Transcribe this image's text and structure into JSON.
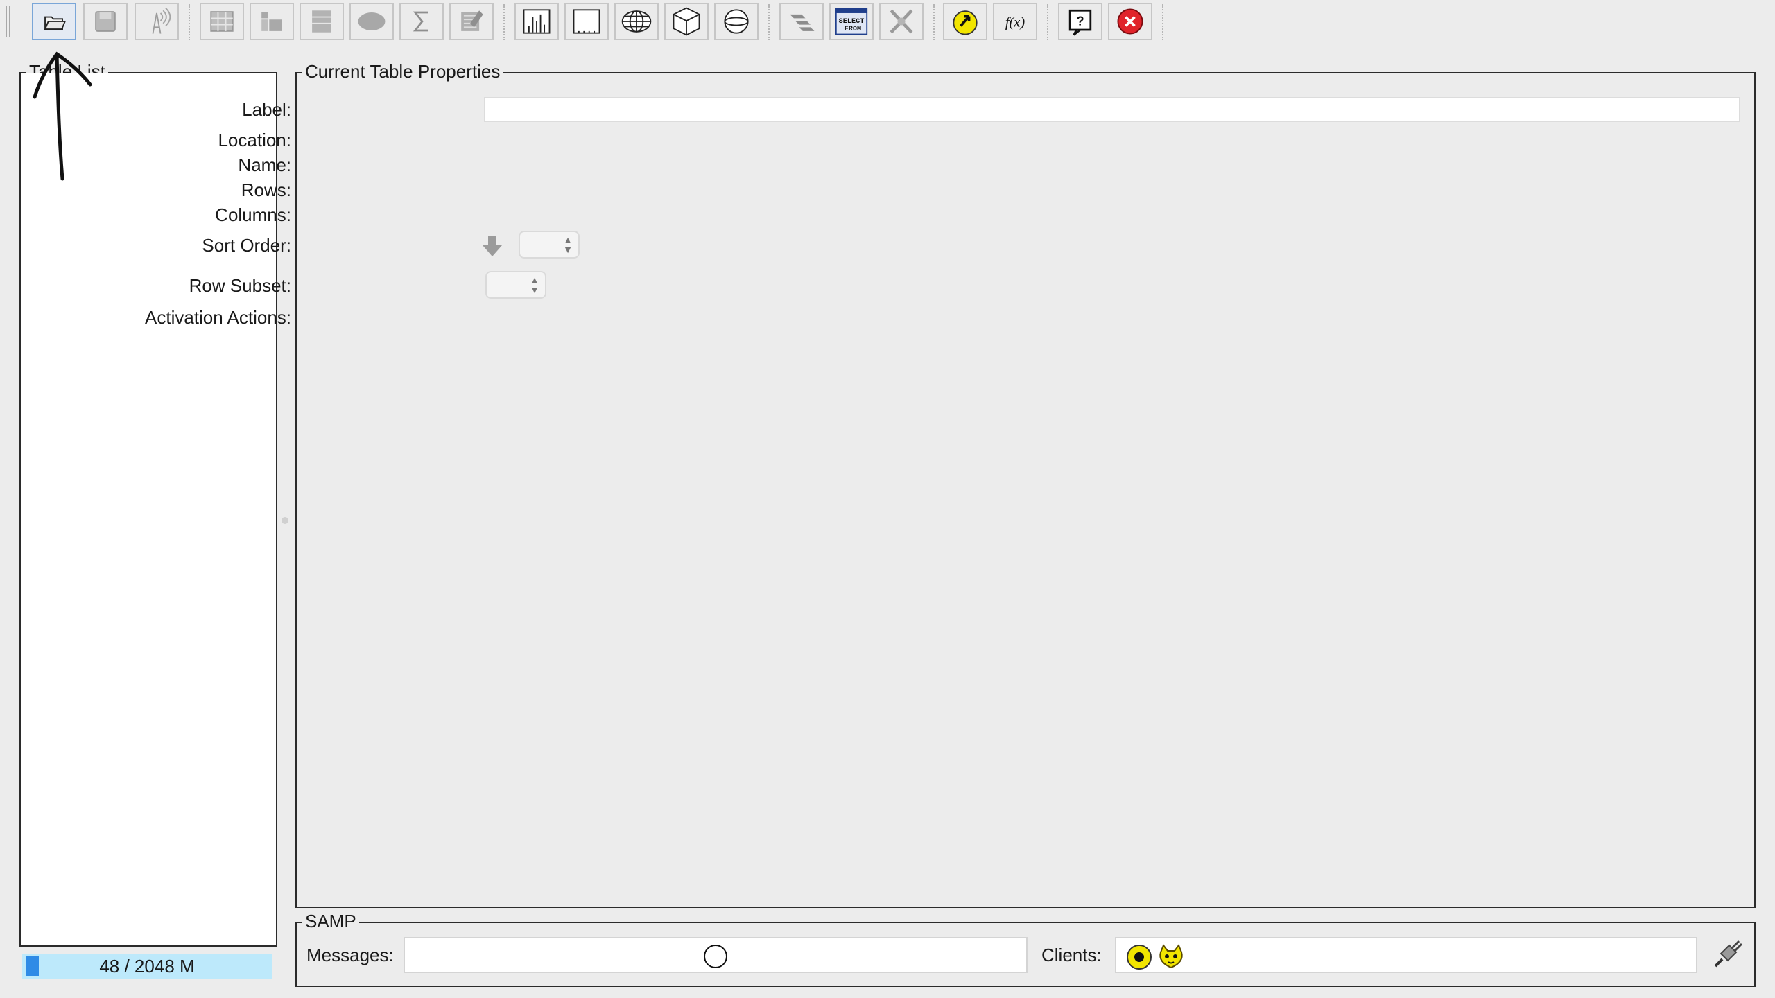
{
  "toolbar": {
    "buttons": [
      {
        "name": "load-table",
        "icon": "folder-open-icon"
      },
      {
        "name": "save-table",
        "icon": "floppy-disk-icon"
      },
      {
        "name": "broadcast-table",
        "icon": "broadcast-antenna-icon"
      },
      {
        "name": "table-data",
        "icon": "table-grid-icon"
      },
      {
        "name": "table-metadata",
        "icon": "metadata-icon"
      },
      {
        "name": "column-info",
        "icon": "column-info-icon"
      },
      {
        "name": "subsets",
        "icon": "subset-ellipse-icon"
      },
      {
        "name": "statistics",
        "icon": "sigma-icon"
      },
      {
        "name": "activation-actions",
        "icon": "activation-icon"
      },
      {
        "name": "histogram-plot",
        "icon": "histogram-icon"
      },
      {
        "name": "plane-plot",
        "icon": "plane-plot-icon"
      },
      {
        "name": "sky-plot",
        "icon": "globe-icon"
      },
      {
        "name": "cube-plot",
        "icon": "cube-icon"
      },
      {
        "name": "sphere-plot",
        "icon": "sphere-icon"
      },
      {
        "name": "match",
        "icon": "match-pair-icon"
      },
      {
        "name": "adql-query",
        "icon": "select-from-icon"
      },
      {
        "name": "concatenate",
        "icon": "cross-match-icon"
      },
      {
        "name": "samp-hub",
        "icon": "samp-hub-icon"
      },
      {
        "name": "functions",
        "icon": "function-icon"
      },
      {
        "name": "help",
        "icon": "help-icon"
      },
      {
        "name": "exit",
        "icon": "stop-icon"
      }
    ],
    "select_from_text": "SELECT FROM",
    "function_text": "f(x)"
  },
  "table_list": {
    "title": "Table List"
  },
  "properties": {
    "title": "Current Table Properties",
    "label_label": "Label:",
    "label_value": "",
    "location_label": "Location:",
    "name_label": "Name:",
    "rows_label": "Rows:",
    "columns_label": "Columns:",
    "sort_order_label": "Sort Order:",
    "row_subset_label": "Row Subset:",
    "activation_label": "Activation Actions:"
  },
  "samp": {
    "title": "SAMP",
    "messages_label": "Messages:",
    "clients_label": "Clients:"
  },
  "memory": {
    "text": "48 / 2048 M",
    "used_fraction": 0.023
  },
  "colors": {
    "memory_bar": "#bde9fb",
    "memory_fill": "#2f8be6",
    "stop": "#e0232a",
    "samp_yellow": "#f2e500"
  }
}
